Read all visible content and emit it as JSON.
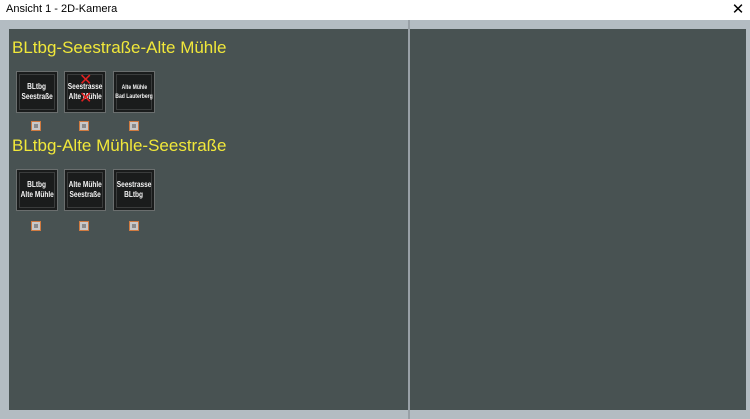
{
  "window": {
    "title": "Ansicht 1 - 2D-Kamera",
    "close_glyph": "✕"
  },
  "groups": [
    {
      "heading": "BLtbg-Seestraße-Alte Mühle",
      "tiles": [
        {
          "lines": [
            "BLtbg",
            "Seestraße"
          ],
          "crossed": false
        },
        {
          "lines": [
            "Seestrasse",
            "Alte Mühle"
          ],
          "crossed": true
        },
        {
          "lines": [
            "Alte Mühle",
            "Bad Lauterberg"
          ],
          "crossed": false
        }
      ]
    },
    {
      "heading": "BLtbg-Alte Mühle-Seestraße",
      "tiles": [
        {
          "lines": [
            "BLtbg",
            "Alte Mühle"
          ],
          "crossed": false
        },
        {
          "lines": [
            "Alte Mühle",
            "Seestraße"
          ],
          "crossed": false
        },
        {
          "lines": [
            "Seestrasse",
            "BLtbg"
          ],
          "crossed": false
        }
      ]
    }
  ],
  "colors": {
    "heading": "#f1e83a",
    "pane_background": "#485252",
    "cross_mark": "#e02020"
  }
}
